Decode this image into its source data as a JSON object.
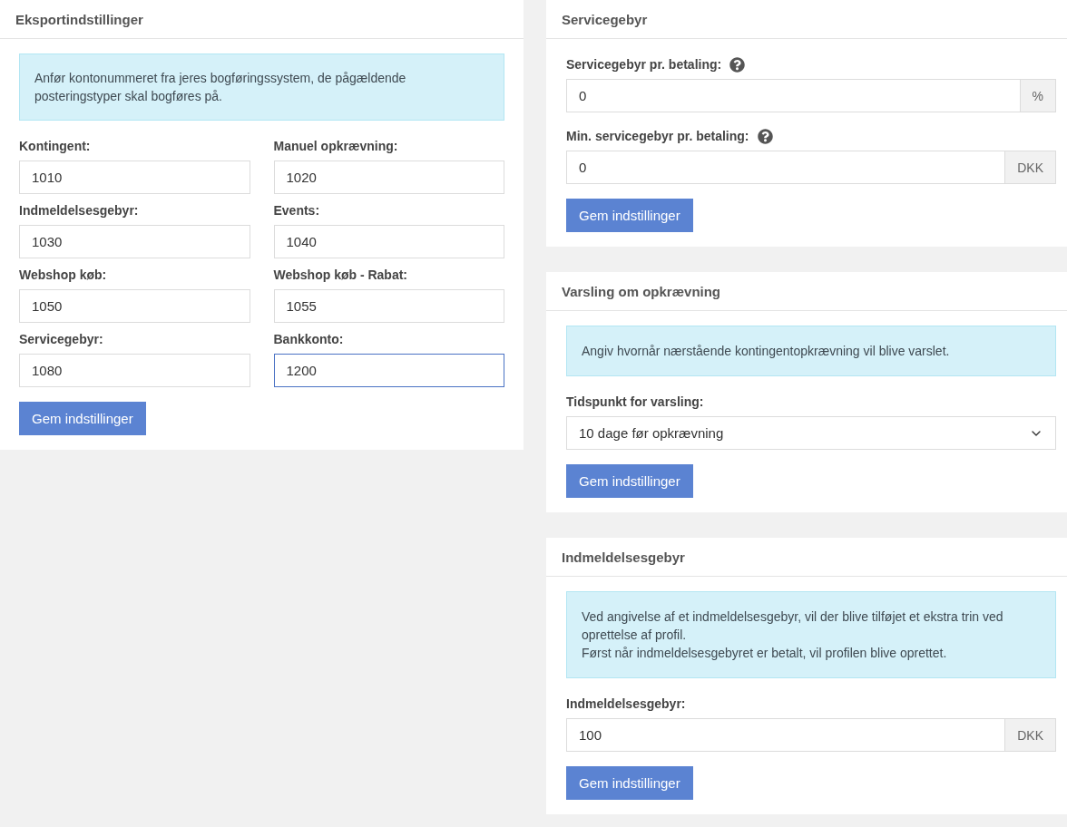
{
  "export_settings": {
    "title": "Eksportindstillinger",
    "info": [
      "Anfør kontonummeret fra jeres bogføringssystem, de pågældende posteringstyper skal bogføres på."
    ],
    "fields": [
      {
        "label": "Kontingent:",
        "value": "1010",
        "focused": false
      },
      {
        "label": "Manuel opkrævning:",
        "value": "1020",
        "focused": false
      },
      {
        "label": "Indmeldelsesgebyr:",
        "value": "1030",
        "focused": false
      },
      {
        "label": "Events:",
        "value": "1040",
        "focused": false
      },
      {
        "label": "Webshop køb:",
        "value": "1050",
        "focused": false
      },
      {
        "label": "Webshop køb - Rabat:",
        "value": "1055",
        "focused": false
      },
      {
        "label": "Servicegebyr:",
        "value": "1080",
        "focused": false
      },
      {
        "label": "Bankkonto:",
        "value": "1200",
        "focused": true
      }
    ],
    "button": "Gem indstillinger"
  },
  "cards": [
    {
      "title": "Servicegebyr",
      "fields": [
        {
          "kind": "input",
          "label": "Servicegebyr pr. betaling:",
          "help": true,
          "value": "0",
          "addon": "%"
        },
        {
          "kind": "input",
          "label": "Min. servicegebyr pr. betaling:",
          "help": true,
          "value": "0",
          "addon": "DKK"
        }
      ],
      "button": "Gem indstillinger"
    },
    {
      "title": "Varsling om opkrævning",
      "info": [
        "Angiv hvornår nærstående kontingentopkrævning vil blive varslet."
      ],
      "fields": [
        {
          "kind": "select",
          "label": "Tidspunkt for varsling:",
          "help": false,
          "value": "10 dage før opkrævning"
        }
      ],
      "button": "Gem indstillinger"
    },
    {
      "title": "Indmeldelsesgebyr",
      "info": [
        "Ved angivelse af et indmeldelsesgebyr, vil der blive tilføjet et ekstra trin ved oprettelse af profil.",
        "Først når indmeldelsesgebyret er betalt, vil profilen blive oprettet."
      ],
      "fields": [
        {
          "kind": "input",
          "label": "Indmeldelsesgebyr:",
          "help": false,
          "value": "100",
          "addon": "DKK"
        }
      ],
      "button": "Gem indstillinger"
    }
  ]
}
